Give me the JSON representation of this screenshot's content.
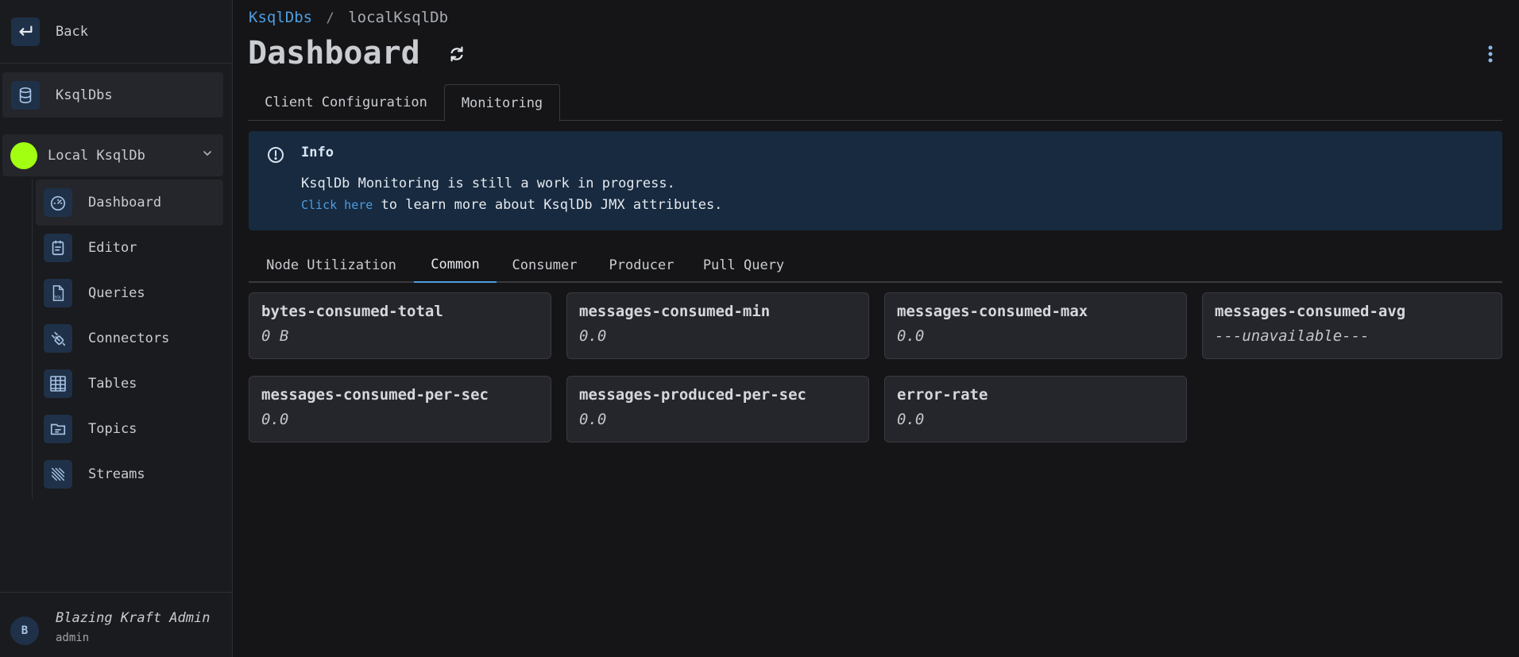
{
  "sidebar": {
    "back_label": "Back",
    "ksqldbs_label": "KsqlDbs",
    "cluster": {
      "name": "Local KsqlDb",
      "color": "#a3ff12"
    },
    "items": [
      {
        "label": "Dashboard",
        "icon": "gauge-icon",
        "active": true
      },
      {
        "label": "Editor",
        "icon": "editor-icon"
      },
      {
        "label": "Queries",
        "icon": "sql-file-icon"
      },
      {
        "label": "Connectors",
        "icon": "connectors-icon"
      },
      {
        "label": "Tables",
        "icon": "table-icon"
      },
      {
        "label": "Topics",
        "icon": "topics-icon"
      },
      {
        "label": "Streams",
        "icon": "streams-icon"
      }
    ],
    "user": {
      "initial": "B",
      "name": "Blazing Kraft Admin",
      "role": "admin"
    }
  },
  "breadcrumb": {
    "root": "KsqlDbs",
    "separator": "/",
    "current": "localKsqlDb"
  },
  "page_title": "Dashboard",
  "tabs": [
    {
      "label": "Client Configuration"
    },
    {
      "label": "Monitoring",
      "active": true
    }
  ],
  "info": {
    "title": "Info",
    "line1": "KsqlDb Monitoring is still a work in progress.",
    "link": "Click here",
    "line2_rest": " to learn more about KsqlDb JMX attributes."
  },
  "subtabs": [
    {
      "label": "Node Utilization"
    },
    {
      "label": "Common",
      "active": true
    },
    {
      "label": "Consumer"
    },
    {
      "label": "Producer"
    },
    {
      "label": "Pull Query"
    }
  ],
  "metrics": [
    {
      "name": "bytes-consumed-total",
      "value": "0 B"
    },
    {
      "name": "messages-consumed-min",
      "value": "0.0"
    },
    {
      "name": "messages-consumed-max",
      "value": "0.0"
    },
    {
      "name": "messages-consumed-avg",
      "value": "---unavailable---"
    },
    {
      "name": "messages-consumed-per-sec",
      "value": "0.0"
    },
    {
      "name": "messages-produced-per-sec",
      "value": "0.0"
    },
    {
      "name": "error-rate",
      "value": "0.0"
    }
  ],
  "colors": {
    "accent": "#4d9de0",
    "info_bg": "#172a40",
    "card_bg": "#25262b"
  }
}
